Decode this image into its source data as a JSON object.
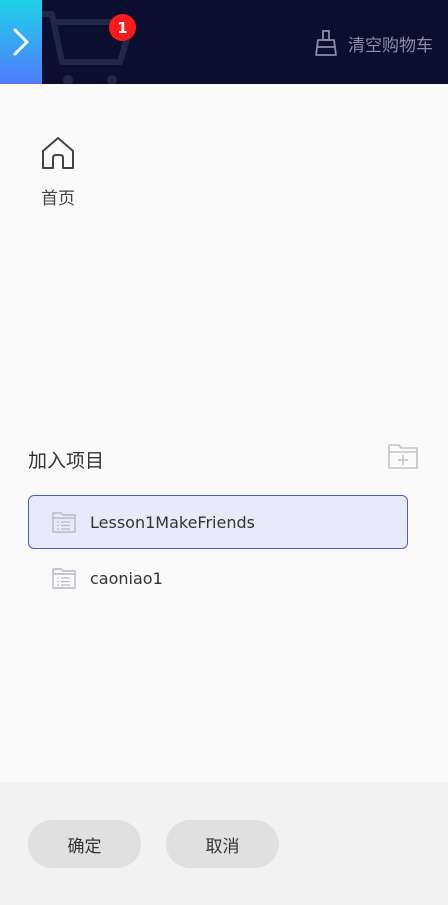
{
  "header": {
    "cart_count": "1",
    "clear_cart_label": "清空购物车"
  },
  "nav": {
    "home_label": "首页"
  },
  "projects": {
    "title": "加入项目",
    "items": [
      {
        "label": "Lesson1MakeFriends",
        "selected": true
      },
      {
        "label": "caoniao1",
        "selected": false
      }
    ]
  },
  "footer": {
    "confirm_label": "确定",
    "cancel_label": "取消"
  },
  "colors": {
    "topbar_bg": "#0b0e2e",
    "badge": "#ff1a1a",
    "selected_border": "#4e5bc9",
    "selected_bg": "#e8eafb"
  },
  "icons": [
    "chevron-right-icon",
    "cart-icon",
    "broom-icon",
    "home-icon",
    "folder-add-icon",
    "list-icon"
  ]
}
